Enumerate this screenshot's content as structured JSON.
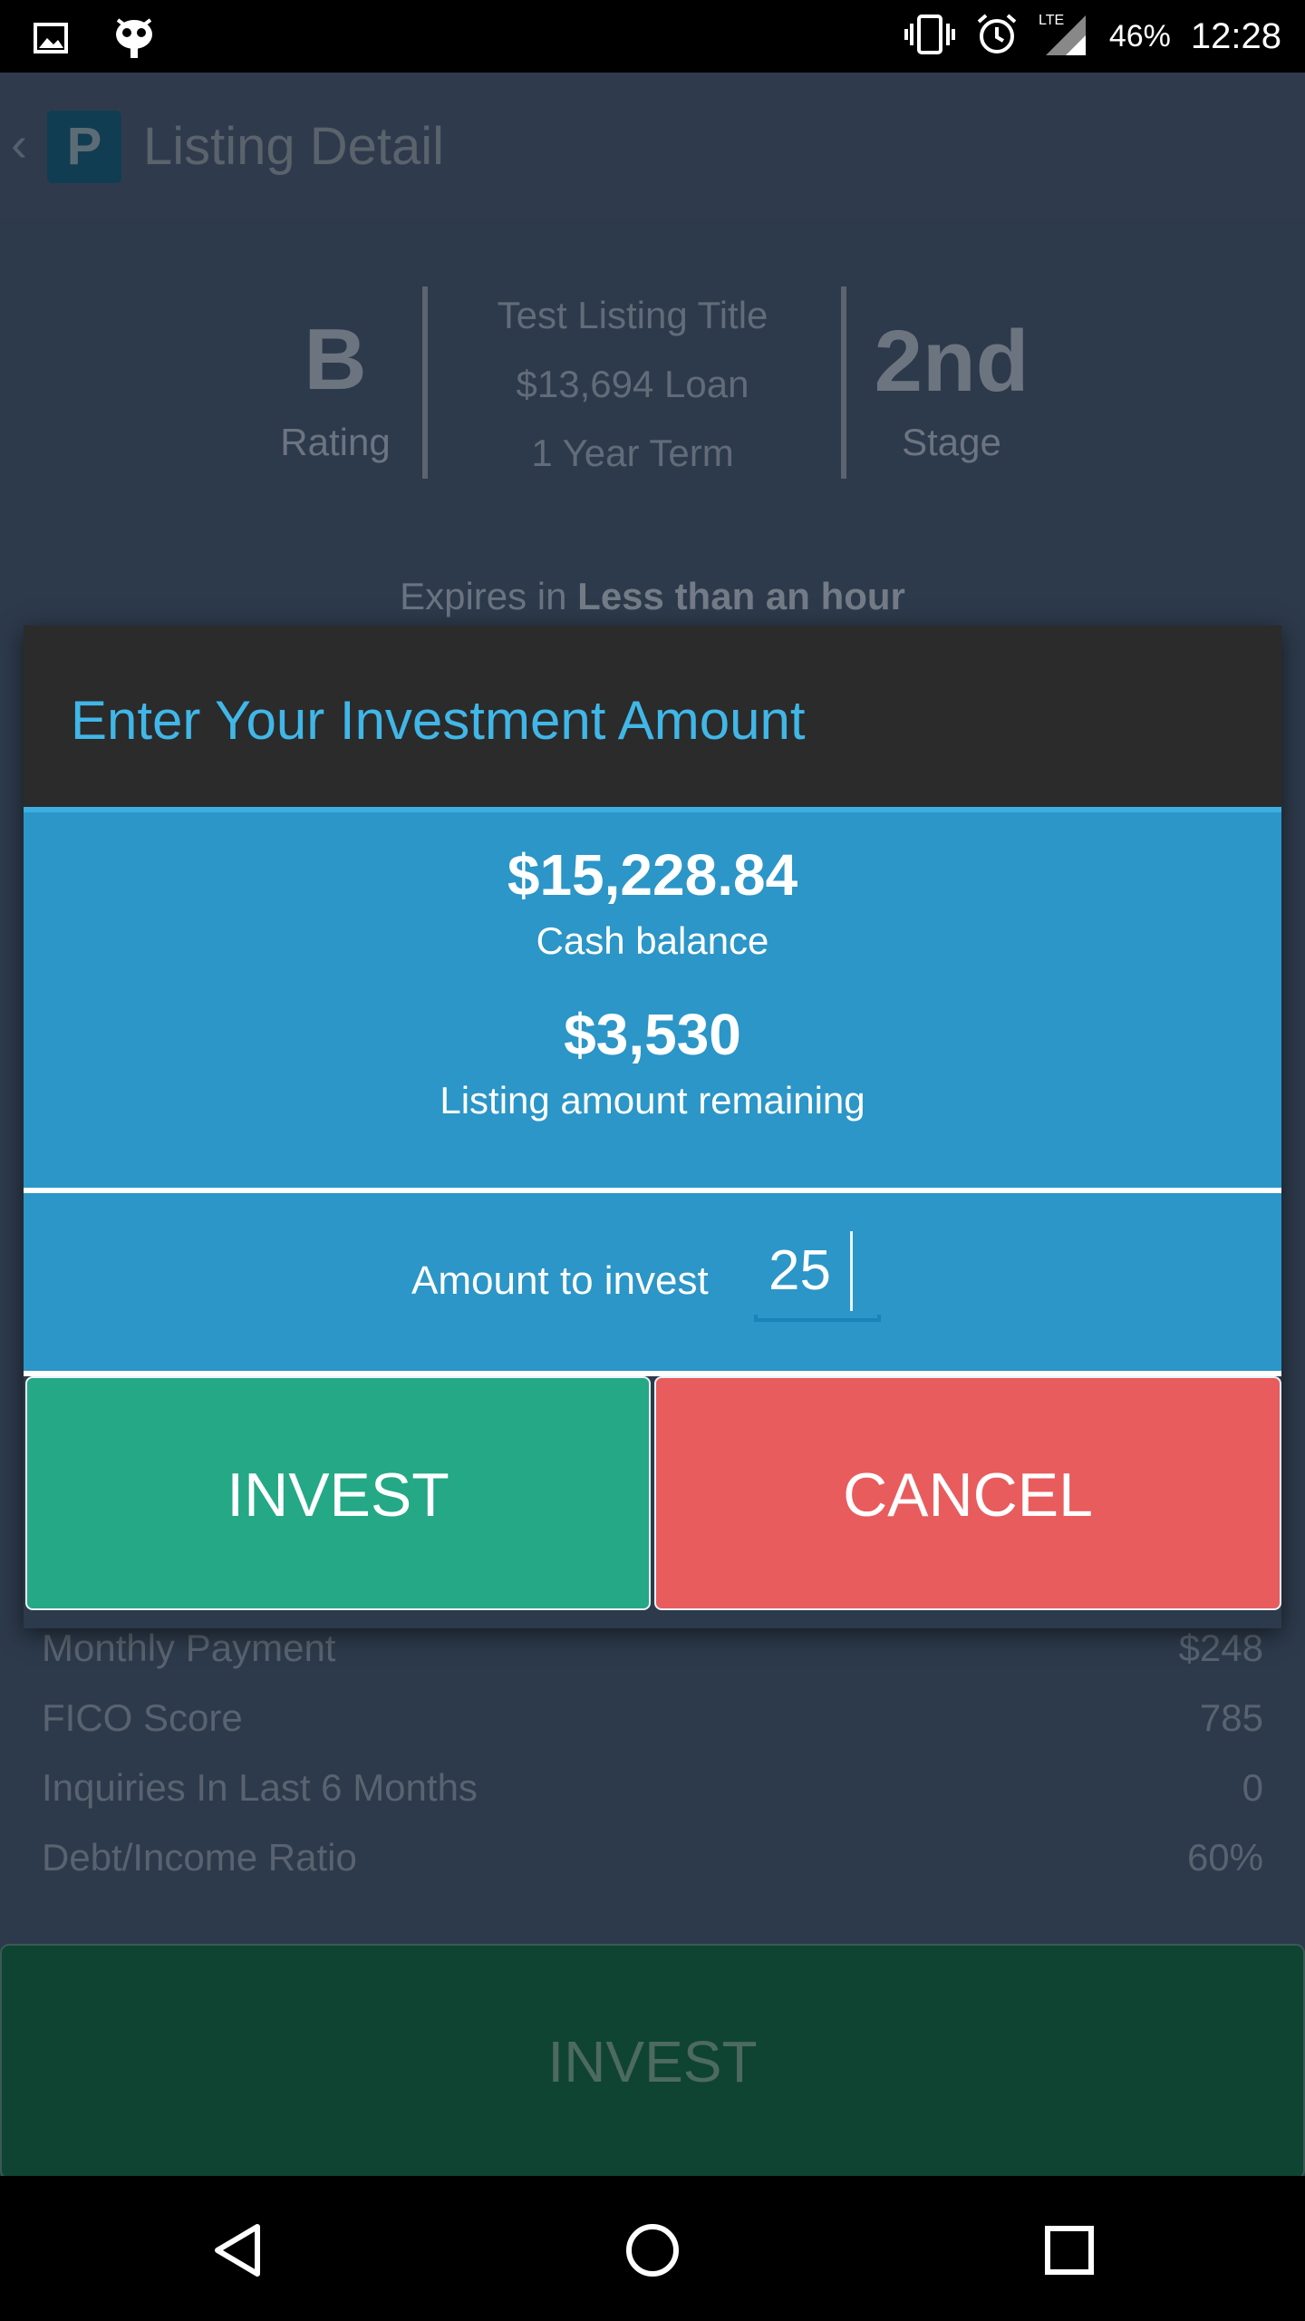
{
  "status_bar": {
    "battery": "46%",
    "time": "12:28",
    "network": "LTE",
    "icons": [
      "image-icon",
      "bot-icon",
      "vibrate-icon",
      "alarm-icon",
      "signal-icon"
    ]
  },
  "app_bar": {
    "back": "‹",
    "logo_letter": "P",
    "title": "Listing Detail"
  },
  "listing": {
    "rating_grade": "B",
    "rating_label": "Rating",
    "title": "Test Listing Title",
    "loan": "$13,694 Loan",
    "term": "1 Year Term",
    "stage_value": "2nd",
    "stage_label": "Stage",
    "expires_prefix": "Expires in",
    "expires_value": "Less than an hour"
  },
  "details": [
    {
      "label": "Monthly Payment",
      "value": "$248"
    },
    {
      "label": "FICO Score",
      "value": "785"
    },
    {
      "label": "Inquiries In Last 6 Months",
      "value": "0"
    },
    {
      "label": "Debt/Income Ratio",
      "value": "60%"
    }
  ],
  "background_button": "INVEST",
  "dialog": {
    "title": "Enter Your Investment Amount",
    "cash_balance": "$15,228.84",
    "cash_balance_label": "Cash balance",
    "remaining": "$3,530",
    "remaining_label": "Listing amount remaining",
    "amount_label": "Amount to invest",
    "amount_value": "25",
    "invest_label": "INVEST",
    "cancel_label": "CANCEL"
  },
  "colors": {
    "accent": "#3daee3",
    "panel": "#2b96c7",
    "invest": "#24a886",
    "cancel": "#e85c5e"
  }
}
